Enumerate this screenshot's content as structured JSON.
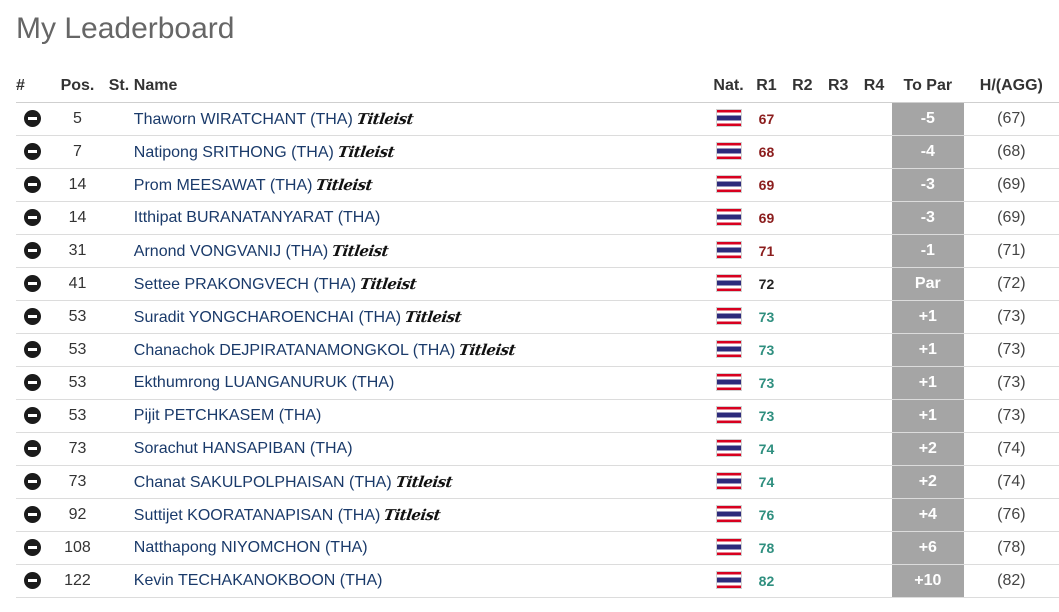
{
  "title": "My Leaderboard",
  "columns": {
    "num": "#",
    "pos": "Pos.",
    "st": "St.",
    "name": "Name",
    "nat": "Nat.",
    "r1": "R1",
    "r2": "R2",
    "r3": "R3",
    "r4": "R4",
    "topar": "To Par",
    "agg": "H/(AGG)"
  },
  "brand_label": "Titleist",
  "colors": {
    "over_par": "#2f8f7f",
    "under_par": "#8b1d1d",
    "even": "#222222",
    "topar_bg": "#a5a5a5"
  },
  "rows": [
    {
      "pos": "5",
      "name": "Thaworn WIRATCHANT (THA)",
      "brand": true,
      "r1": "67",
      "r1class": "red",
      "topar": "-5",
      "agg": "(67)"
    },
    {
      "pos": "7",
      "name": "Natipong SRITHONG (THA)",
      "brand": true,
      "r1": "68",
      "r1class": "red",
      "topar": "-4",
      "agg": "(68)"
    },
    {
      "pos": "14",
      "name": "Prom MEESAWAT (THA)",
      "brand": true,
      "r1": "69",
      "r1class": "red",
      "topar": "-3",
      "agg": "(69)"
    },
    {
      "pos": "14",
      "name": "Itthipat BURANATANYARAT (THA)",
      "brand": false,
      "r1": "69",
      "r1class": "red",
      "topar": "-3",
      "agg": "(69)"
    },
    {
      "pos": "31",
      "name": "Arnond VONGVANIJ (THA)",
      "brand": true,
      "r1": "71",
      "r1class": "red",
      "topar": "-1",
      "agg": "(71)"
    },
    {
      "pos": "41",
      "name": "Settee PRAKONGVECH (THA)",
      "brand": true,
      "r1": "72",
      "r1class": "even",
      "topar": "Par",
      "agg": "(72)"
    },
    {
      "pos": "53",
      "name": "Suradit YONGCHAROENCHAI (THA)",
      "brand": true,
      "r1": "73",
      "r1class": "green",
      "topar": "+1",
      "agg": "(73)"
    },
    {
      "pos": "53",
      "name": "Chanachok DEJPIRATANAMONGKOL (THA)",
      "brand": true,
      "r1": "73",
      "r1class": "green",
      "topar": "+1",
      "agg": "(73)"
    },
    {
      "pos": "53",
      "name": "Ekthumrong LUANGANURUK (THA)",
      "brand": false,
      "r1": "73",
      "r1class": "green",
      "topar": "+1",
      "agg": "(73)"
    },
    {
      "pos": "53",
      "name": "Pijit PETCHKASEM (THA)",
      "brand": false,
      "r1": "73",
      "r1class": "green",
      "topar": "+1",
      "agg": "(73)"
    },
    {
      "pos": "73",
      "name": "Sorachut HANSAPIBAN (THA)",
      "brand": false,
      "r1": "74",
      "r1class": "green",
      "topar": "+2",
      "agg": "(74)"
    },
    {
      "pos": "73",
      "name": "Chanat SAKULPOLPHAISAN (THA)",
      "brand": true,
      "r1": "74",
      "r1class": "green",
      "topar": "+2",
      "agg": "(74)"
    },
    {
      "pos": "92",
      "name": "Suttijet KOORATANAPISAN (THA)",
      "brand": true,
      "r1": "76",
      "r1class": "green",
      "topar": "+4",
      "agg": "(76)"
    },
    {
      "pos": "108",
      "name": "Natthapong NIYOMCHON (THA)",
      "brand": false,
      "r1": "78",
      "r1class": "green",
      "topar": "+6",
      "agg": "(78)"
    },
    {
      "pos": "122",
      "name": "Kevin TECHAKANOKBOON (THA)",
      "brand": false,
      "r1": "82",
      "r1class": "green",
      "topar": "+10",
      "agg": "(82)"
    }
  ]
}
